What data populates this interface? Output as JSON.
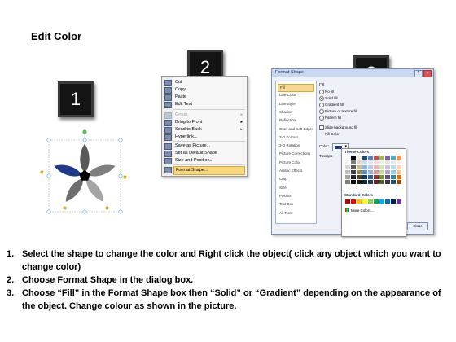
{
  "title": "Edit Color",
  "badges": [
    "1",
    "2",
    "3"
  ],
  "context_menu": {
    "items": [
      {
        "label": "Cut",
        "disabled": false,
        "submenu": false,
        "highlight": false
      },
      {
        "label": "Copy",
        "disabled": false,
        "submenu": false,
        "highlight": false
      },
      {
        "label": "Paste",
        "disabled": false,
        "submenu": false,
        "highlight": false
      },
      {
        "label": "Edit Text",
        "disabled": false,
        "submenu": false,
        "highlight": false
      },
      {
        "label": "Group",
        "disabled": true,
        "submenu": true,
        "highlight": false
      },
      {
        "label": "Bring to Front",
        "disabled": false,
        "submenu": true,
        "highlight": false
      },
      {
        "label": "Send to Back",
        "disabled": false,
        "submenu": true,
        "highlight": false
      },
      {
        "label": "Hyperlink...",
        "disabled": false,
        "submenu": false,
        "highlight": false
      },
      {
        "label": "Save as Picture...",
        "disabled": false,
        "submenu": false,
        "highlight": false
      },
      {
        "label": "Set as Default Shape",
        "disabled": false,
        "submenu": false,
        "highlight": false
      },
      {
        "label": "Size and Position...",
        "disabled": false,
        "submenu": false,
        "highlight": false
      },
      {
        "label": "Format Shape...",
        "disabled": false,
        "submenu": false,
        "highlight": true
      }
    ]
  },
  "format_dialog": {
    "title": "Format Shape",
    "nav_items": [
      "Fill",
      "Line Color",
      "Line Style",
      "Shadow",
      "Reflection",
      "Glow and Soft Edges",
      "3-D Format",
      "3-D Rotation",
      "Picture Corrections",
      "Picture Color",
      "Artistic Effects",
      "Crop",
      "Size",
      "Position",
      "Text Box",
      "Alt Text"
    ],
    "selected_nav": "Fill",
    "section_title": "Fill",
    "fill_options": [
      {
        "label": "No fill",
        "selected": false
      },
      {
        "label": "Solid fill",
        "selected": true
      },
      {
        "label": "Gradient fill",
        "selected": false
      },
      {
        "label": "Picture or texture fill",
        "selected": false
      },
      {
        "label": "Pattern fill",
        "selected": false
      }
    ],
    "slide_background_label": "Slide background fill",
    "fill_color_label": "Fill Color",
    "color_label": "Color:",
    "transparency_label": "Transpa",
    "theme_colors_label": "Theme Colors",
    "standard_colors_label": "Standard Colors",
    "more_colors_label": "More Colors...",
    "close_label": "Close",
    "theme_colors": [
      [
        "#ffffff",
        "#000000",
        "#eeece1",
        "#1f497d",
        "#4f81bd",
        "#c0504d",
        "#9bbb59",
        "#8064a2",
        "#4bacc6",
        "#f79646"
      ],
      [
        "#f2f2f2",
        "#7f7f7f",
        "#ddd9c3",
        "#c6d9f0",
        "#dbe5f1",
        "#f2dcdb",
        "#ebf1dd",
        "#e5e0ec",
        "#dbeef3",
        "#fdeada"
      ],
      [
        "#d8d8d8",
        "#595959",
        "#c4bd97",
        "#8db3e2",
        "#b8cce4",
        "#e5b9b7",
        "#d7e3bc",
        "#ccc1d9",
        "#b7dde8",
        "#fbd5b5"
      ],
      [
        "#bfbfbf",
        "#3f3f3f",
        "#938953",
        "#548dd4",
        "#95b3d7",
        "#d99694",
        "#c3d69b",
        "#b2a2c7",
        "#92cddc",
        "#fac08f"
      ],
      [
        "#a5a5a5",
        "#262626",
        "#494429",
        "#17365d",
        "#366092",
        "#953734",
        "#76923c",
        "#5f497a",
        "#31859b",
        "#e36c09"
      ],
      [
        "#7f7f7f",
        "#0c0c0c",
        "#1d1b10",
        "#0f243e",
        "#244061",
        "#632423",
        "#4f6128",
        "#3f3151",
        "#205867",
        "#974806"
      ]
    ],
    "standard_colors": [
      "#c00000",
      "#ff0000",
      "#ffc000",
      "#ffff00",
      "#92d050",
      "#00b050",
      "#00b0f0",
      "#0070c0",
      "#002060",
      "#7030a0"
    ],
    "selected_color": "#1f3a8a"
  },
  "shape": {
    "selected_petal_color": "#1f3a8a",
    "petal_colors": [
      "#595959",
      "#7f7f7f",
      "#a5a5a5",
      "#6d6d6d"
    ],
    "center_color": "#000000",
    "handle_color": "#7ab8d8",
    "rotate_handle_color": "#5cb85c"
  },
  "steps": [
    {
      "num": "1.",
      "text": "Select the shape to change the color and Right click the object( click any object which you want to change color)"
    },
    {
      "num": "2.",
      "text": "Choose Format Shape in the dialog box."
    },
    {
      "num": "3.",
      "text": "Choose “Fill” in the Format Shape box then “Solid” or “Gradient” depending on the appearance of the object. Change colour as shown in the picture."
    }
  ]
}
